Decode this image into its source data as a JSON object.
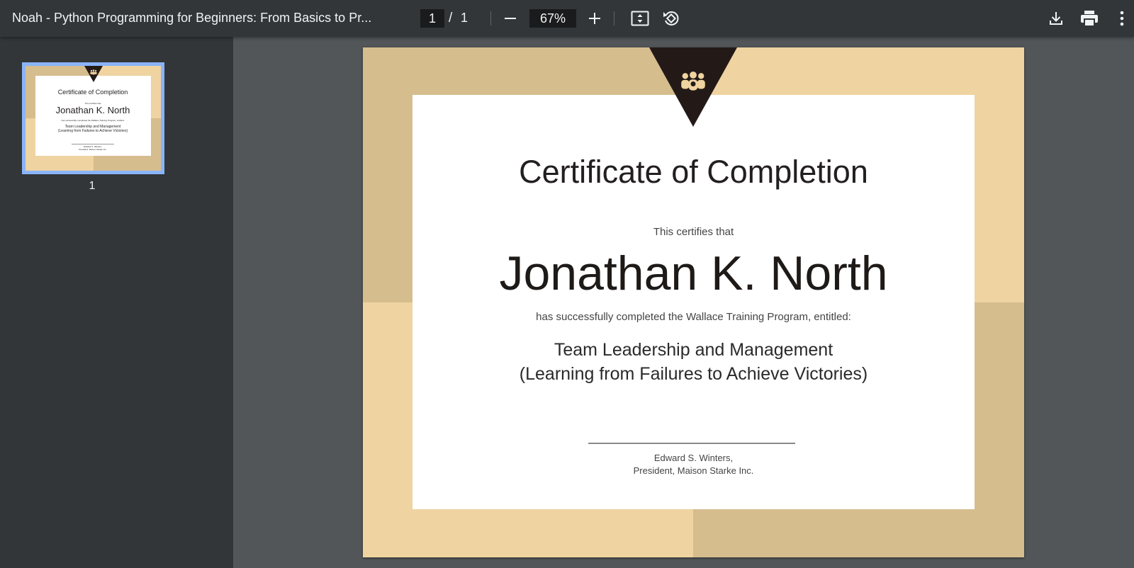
{
  "toolbar": {
    "title": "Noah - Python Programming for Beginners: From Basics to Pr...",
    "current_page": "1",
    "page_separator": "/",
    "total_pages": "1",
    "zoom": "67%"
  },
  "sidebar": {
    "thumbnails": [
      {
        "page_label": "1"
      }
    ]
  },
  "certificate": {
    "title": "Certificate of Completion",
    "certifies": "This certifies that",
    "recipient": "Jonathan K. North",
    "completed": "has successfully completed the Wallace Training Program, entitled:",
    "course_line1": "Team Leadership and Management",
    "course_line2": "(Learning from Failures to Achieve Victories)",
    "signer_name": "Edward S. Winters,",
    "signer_role": "President, Maison Starke Inc."
  },
  "colors": {
    "toolbar": "#323639",
    "viewer_bg": "#525659",
    "thumb_selected": "#8ab4f8",
    "page_tan_light": "#efd3a0",
    "page_tan_dark": "#d6bd8e",
    "ribbon": "#231a18"
  },
  "icons": {
    "zoom_out": "minus-icon",
    "zoom_in": "plus-icon",
    "fit": "fit-to-page-icon",
    "rotate": "rotate-icon",
    "download": "download-icon",
    "print": "print-icon",
    "more": "more-vert-icon",
    "emblem": "team-people-icon"
  }
}
